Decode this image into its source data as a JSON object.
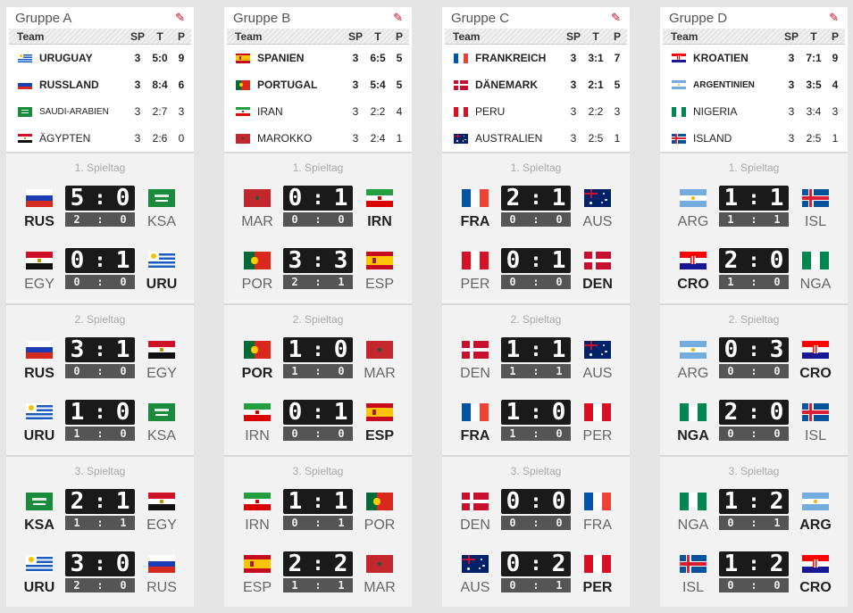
{
  "columns": {
    "team": "Team",
    "sp": "SP",
    "t": "T",
    "p": "P"
  },
  "groups": [
    {
      "title": "Gruppe A",
      "standings": [
        {
          "flag": "uru",
          "name": "URUGUAY",
          "sp": "3",
          "t": "5:0",
          "p": "9",
          "bold": true
        },
        {
          "flag": "rus",
          "name": "RUSSLAND",
          "sp": "3",
          "t": "8:4",
          "p": "6",
          "bold": true
        },
        {
          "flag": "ksa",
          "name": "SAUDI-ARABIEN",
          "sp": "3",
          "t": "2:7",
          "p": "3",
          "bold": false
        },
        {
          "flag": "egy",
          "name": "ÄGYPTEN",
          "sp": "3",
          "t": "2:6",
          "p": "0",
          "bold": false
        }
      ],
      "rounds": [
        {
          "title": "1. Spieltag",
          "matches": [
            {
              "f1": "rus",
              "c1": "RUS",
              "w1": true,
              "s1": "5",
              "s2": "0",
              "h1": "2",
              "h2": "0",
              "f2": "ksa",
              "c2": "KSA",
              "w2": false
            },
            {
              "f1": "egy",
              "c1": "EGY",
              "w1": false,
              "s1": "0",
              "s2": "1",
              "h1": "0",
              "h2": "0",
              "f2": "uru",
              "c2": "URU",
              "w2": true
            }
          ]
        },
        {
          "title": "2. Spieltag",
          "matches": [
            {
              "f1": "rus",
              "c1": "RUS",
              "w1": true,
              "s1": "3",
              "s2": "1",
              "h1": "0",
              "h2": "0",
              "f2": "egy",
              "c2": "EGY",
              "w2": false
            },
            {
              "f1": "uru",
              "c1": "URU",
              "w1": true,
              "s1": "1",
              "s2": "0",
              "h1": "1",
              "h2": "0",
              "f2": "ksa",
              "c2": "KSA",
              "w2": false
            }
          ]
        },
        {
          "title": "3. Spieltag",
          "matches": [
            {
              "f1": "ksa",
              "c1": "KSA",
              "w1": true,
              "s1": "2",
              "s2": "1",
              "h1": "1",
              "h2": "1",
              "f2": "egy",
              "c2": "EGY",
              "w2": false
            },
            {
              "f1": "uru",
              "c1": "URU",
              "w1": true,
              "s1": "3",
              "s2": "0",
              "h1": "2",
              "h2": "0",
              "f2": "rus",
              "c2": "RUS",
              "w2": false
            }
          ]
        }
      ]
    },
    {
      "title": "Gruppe B",
      "standings": [
        {
          "flag": "esp",
          "name": "SPANIEN",
          "sp": "3",
          "t": "6:5",
          "p": "5",
          "bold": true
        },
        {
          "flag": "por",
          "name": "PORTUGAL",
          "sp": "3",
          "t": "5:4",
          "p": "5",
          "bold": true
        },
        {
          "flag": "irn",
          "name": "IRAN",
          "sp": "3",
          "t": "2:2",
          "p": "4",
          "bold": false
        },
        {
          "flag": "mar",
          "name": "MAROKKO",
          "sp": "3",
          "t": "2:4",
          "p": "1",
          "bold": false
        }
      ],
      "rounds": [
        {
          "title": "1. Spieltag",
          "matches": [
            {
              "f1": "mar",
              "c1": "MAR",
              "w1": false,
              "s1": "0",
              "s2": "1",
              "h1": "0",
              "h2": "0",
              "f2": "irn",
              "c2": "IRN",
              "w2": true
            },
            {
              "f1": "por",
              "c1": "POR",
              "w1": false,
              "s1": "3",
              "s2": "3",
              "h1": "2",
              "h2": "1",
              "f2": "esp",
              "c2": "ESP",
              "w2": false
            }
          ]
        },
        {
          "title": "2. Spieltag",
          "matches": [
            {
              "f1": "por",
              "c1": "POR",
              "w1": true,
              "s1": "1",
              "s2": "0",
              "h1": "1",
              "h2": "0",
              "f2": "mar",
              "c2": "MAR",
              "w2": false
            },
            {
              "f1": "irn",
              "c1": "IRN",
              "w1": false,
              "s1": "0",
              "s2": "1",
              "h1": "0",
              "h2": "0",
              "f2": "esp",
              "c2": "ESP",
              "w2": true
            }
          ]
        },
        {
          "title": "3. Spieltag",
          "matches": [
            {
              "f1": "irn",
              "c1": "IRN",
              "w1": false,
              "s1": "1",
              "s2": "1",
              "h1": "0",
              "h2": "1",
              "f2": "por",
              "c2": "POR",
              "w2": false
            },
            {
              "f1": "esp",
              "c1": "ESP",
              "w1": false,
              "s1": "2",
              "s2": "2",
              "h1": "1",
              "h2": "1",
              "f2": "mar",
              "c2": "MAR",
              "w2": false
            }
          ]
        }
      ]
    },
    {
      "title": "Gruppe C",
      "standings": [
        {
          "flag": "fra",
          "name": "FRANKREICH",
          "sp": "3",
          "t": "3:1",
          "p": "7",
          "bold": true
        },
        {
          "flag": "den",
          "name": "DÄNEMARK",
          "sp": "3",
          "t": "2:1",
          "p": "5",
          "bold": true
        },
        {
          "flag": "per",
          "name": "PERU",
          "sp": "3",
          "t": "2:2",
          "p": "3",
          "bold": false
        },
        {
          "flag": "aus",
          "name": "AUSTRALIEN",
          "sp": "3",
          "t": "2:5",
          "p": "1",
          "bold": false
        }
      ],
      "rounds": [
        {
          "title": "1. Spieltag",
          "matches": [
            {
              "f1": "fra",
              "c1": "FRA",
              "w1": true,
              "s1": "2",
              "s2": "1",
              "h1": "0",
              "h2": "0",
              "f2": "aus",
              "c2": "AUS",
              "w2": false
            },
            {
              "f1": "per",
              "c1": "PER",
              "w1": false,
              "s1": "0",
              "s2": "1",
              "h1": "0",
              "h2": "0",
              "f2": "den",
              "c2": "DEN",
              "w2": true
            }
          ]
        },
        {
          "title": "2. Spieltag",
          "matches": [
            {
              "f1": "den",
              "c1": "DEN",
              "w1": false,
              "s1": "1",
              "s2": "1",
              "h1": "1",
              "h2": "1",
              "f2": "aus",
              "c2": "AUS",
              "w2": false
            },
            {
              "f1": "fra",
              "c1": "FRA",
              "w1": true,
              "s1": "1",
              "s2": "0",
              "h1": "1",
              "h2": "0",
              "f2": "per",
              "c2": "PER",
              "w2": false
            }
          ]
        },
        {
          "title": "3. Spieltag",
          "matches": [
            {
              "f1": "den",
              "c1": "DEN",
              "w1": false,
              "s1": "0",
              "s2": "0",
              "h1": "0",
              "h2": "0",
              "f2": "fra",
              "c2": "FRA",
              "w2": false
            },
            {
              "f1": "aus",
              "c1": "AUS",
              "w1": false,
              "s1": "0",
              "s2": "2",
              "h1": "0",
              "h2": "1",
              "f2": "per",
              "c2": "PER",
              "w2": true
            }
          ]
        }
      ]
    },
    {
      "title": "Gruppe D",
      "standings": [
        {
          "flag": "cro",
          "name": "KROATIEN",
          "sp": "3",
          "t": "7:1",
          "p": "9",
          "bold": true
        },
        {
          "flag": "arg",
          "name": "ARGENTINIEN",
          "sp": "3",
          "t": "3:5",
          "p": "4",
          "bold": true,
          "small": true
        },
        {
          "flag": "nga",
          "name": "NIGERIA",
          "sp": "3",
          "t": "3:4",
          "p": "3",
          "bold": false
        },
        {
          "flag": "isl",
          "name": "ISLAND",
          "sp": "3",
          "t": "2:5",
          "p": "1",
          "bold": false
        }
      ],
      "rounds": [
        {
          "title": "1. Spieltag",
          "matches": [
            {
              "f1": "arg",
              "c1": "ARG",
              "w1": false,
              "s1": "1",
              "s2": "1",
              "h1": "1",
              "h2": "1",
              "f2": "isl",
              "c2": "ISL",
              "w2": false
            },
            {
              "f1": "cro",
              "c1": "CRO",
              "w1": true,
              "s1": "2",
              "s2": "0",
              "h1": "1",
              "h2": "0",
              "f2": "nga",
              "c2": "NGA",
              "w2": false
            }
          ]
        },
        {
          "title": "2. Spieltag",
          "matches": [
            {
              "f1": "arg",
              "c1": "ARG",
              "w1": false,
              "s1": "0",
              "s2": "3",
              "h1": "0",
              "h2": "0",
              "f2": "cro",
              "c2": "CRO",
              "w2": true
            },
            {
              "f1": "nga",
              "c1": "NGA",
              "w1": true,
              "s1": "2",
              "s2": "0",
              "h1": "0",
              "h2": "0",
              "f2": "isl",
              "c2": "ISL",
              "w2": false
            }
          ]
        },
        {
          "title": "3. Spieltag",
          "matches": [
            {
              "f1": "nga",
              "c1": "NGA",
              "w1": false,
              "s1": "1",
              "s2": "2",
              "h1": "0",
              "h2": "1",
              "f2": "arg",
              "c2": "ARG",
              "w2": true
            },
            {
              "f1": "isl",
              "c1": "ISL",
              "w1": false,
              "s1": "1",
              "s2": "2",
              "h1": "0",
              "h2": "0",
              "f2": "cro",
              "c2": "CRO",
              "w2": true
            }
          ]
        }
      ]
    }
  ],
  "colors": {
    "edit_icon": "#d0021b",
    "board": "#1a1a1a",
    "board_ht": "#555555"
  }
}
